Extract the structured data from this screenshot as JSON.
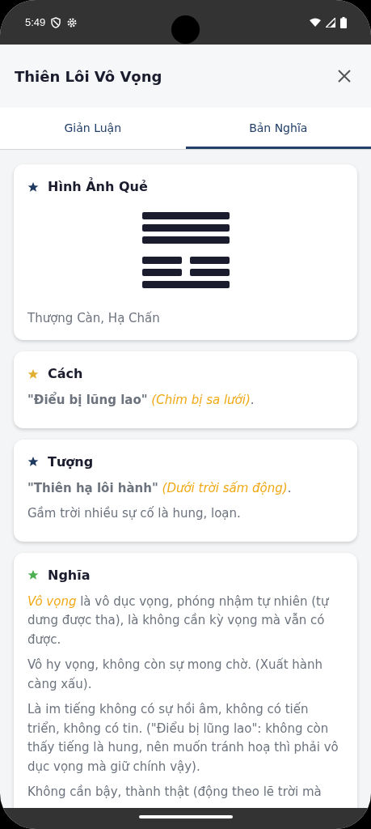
{
  "status_bar": {
    "time": "5:49"
  },
  "header": {
    "title": "Thiên Lôi Vô Vọng"
  },
  "tabs": [
    {
      "label": "Giản Luận",
      "selected": false
    },
    {
      "label": "Bản Nghĩa",
      "selected": true
    }
  ],
  "cards": [
    {
      "kind": "hexagram",
      "title": "Hình Ảnh Quẻ",
      "color": "#1f3a60",
      "lines": [
        {
          "kind": "yang"
        },
        {
          "kind": "yang"
        },
        {
          "kind": "yang"
        },
        {
          "kind": "yin"
        },
        {
          "kind": "yin"
        },
        {
          "kind": "yang"
        }
      ],
      "caption": "Thượng Càn, Hạ Chấn"
    },
    {
      "kind": "text",
      "title": "Cách",
      "color": "#e0b030",
      "paragraphs": [
        "**\"Điểu bị lũng lao\"** *(Chim bị sa lưới)*."
      ]
    },
    {
      "kind": "text",
      "title": "Tượng",
      "color": "#1f3a60",
      "paragraphs": [
        "**\"Thiên hạ lôi hành\"** *(Dưới trời sấm động)*.",
        "Gầm trời nhiều sự cố là hung, loạn."
      ]
    },
    {
      "kind": "text",
      "title": "Nghĩa",
      "color": "#4caf50",
      "paragraphs": [
        "*Vô vọng* là vô dục vọng, phóng nhậm tự nhiên (tự dưng được tha), là không cần kỳ vọng mà vẫn có được.",
        "Vô hy vọng, không còn sự mong chờ. (Xuất hành càng xấu).",
        "Là im tiếng không có sự hồi âm, không có tiến triển, không có tin. (\"Điểu bị lũng lao\": không còn thấy tiếng là hung, nên muốn tránh hoạ thì phải vô dục vọng mà giữ chính vậy).",
        "Không cần bậy, thành thật (động theo lẽ trời mà"
      ]
    }
  ]
}
